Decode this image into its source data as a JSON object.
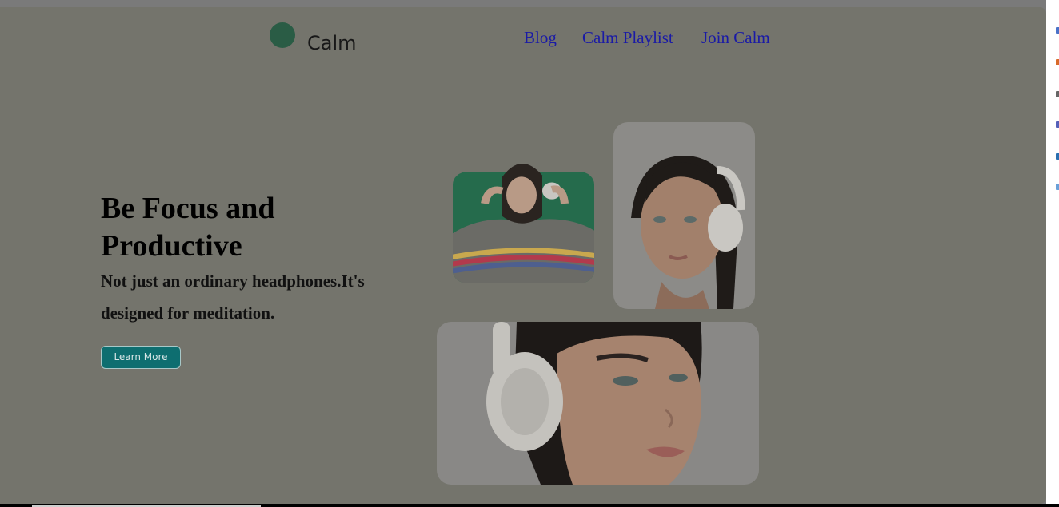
{
  "brand": {
    "name": "Calm",
    "dot_color": "#2a5c45"
  },
  "nav": {
    "links": [
      {
        "label": "Blog"
      },
      {
        "label": "Calm Playlist"
      },
      {
        "label": "Join Calm"
      }
    ]
  },
  "hero": {
    "title": "Be Focus and Productive",
    "subtitle": "Not just an ordinary headphones.It's designed for meditation.",
    "cta_label": "Learn More"
  },
  "gallery": {
    "images": [
      {
        "name": "woman-sweater-headphones-photo"
      },
      {
        "name": "woman-headphones-profile-photo"
      },
      {
        "name": "woman-headphones-closeup-photo"
      }
    ]
  },
  "colors": {
    "accent": "#0e6e70",
    "link": "#1a1aa6",
    "overlay_bg": "#74746c"
  }
}
